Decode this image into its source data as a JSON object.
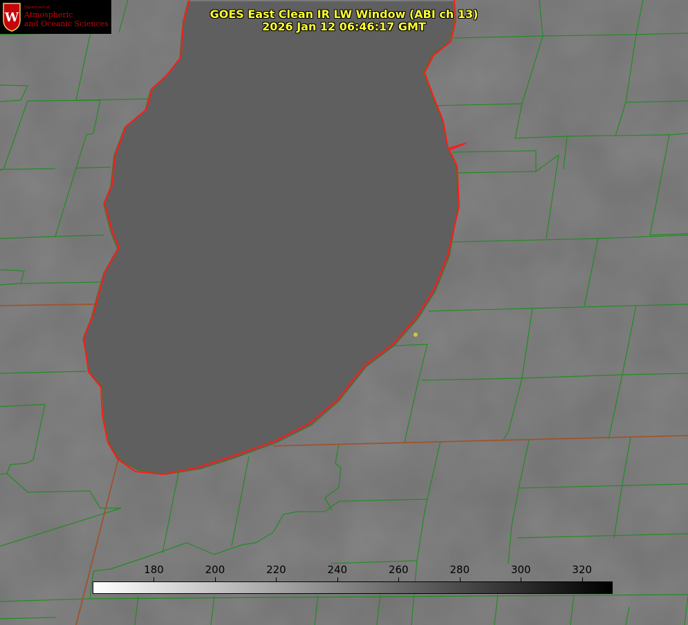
{
  "title": {
    "line1": "GOES East Clean IR LW Window (ABI ch 13)",
    "line2": "2026 Jan 12 06:46:17 GMT"
  },
  "logo": {
    "department": "Department of",
    "line1": "Atmospheric",
    "line2": "and Oceanic Sciences",
    "seal_letter": "W"
  },
  "colorbar": {
    "min": 160,
    "max": 330,
    "ticks": [
      "180",
      "200",
      "220",
      "240",
      "260",
      "280",
      "300",
      "320"
    ]
  },
  "colors": {
    "title": "#ffff33",
    "county_lines": "#228b22",
    "coastline": "#ff0000",
    "state_lines": "#a0522d",
    "station_marker": "#cccc33"
  }
}
